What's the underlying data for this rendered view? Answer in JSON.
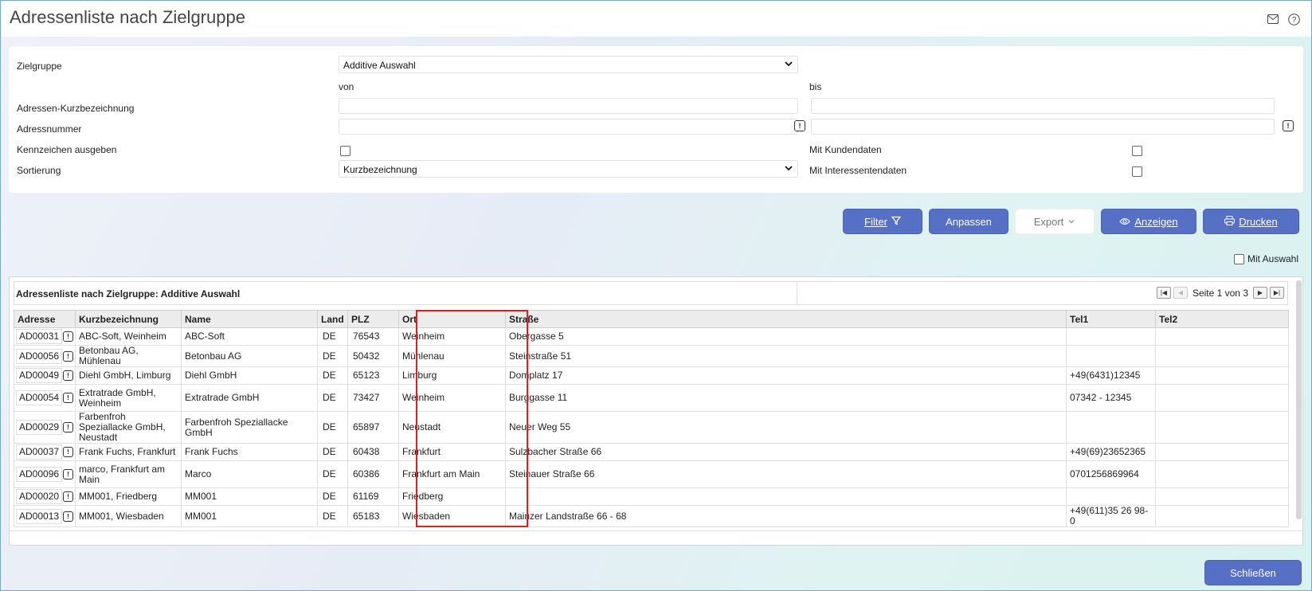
{
  "window": {
    "title": "Adressenliste nach Zielgruppe"
  },
  "header_icons": [
    "mail-icon",
    "help-icon"
  ],
  "form": {
    "zielgruppe_label": "Zielgruppe",
    "zielgruppe_value": "Additive Auswahl",
    "von_label": "von",
    "bis_label": "bis",
    "kurzbez_label": "Adressen-Kurzbezeichnung",
    "kurzbez_von": "",
    "kurzbez_bis": "",
    "adrnr_label": "Adressnummer",
    "adrnr_von": "",
    "adrnr_bis": "",
    "kennzeichen_label": "Kennzeichen ausgeben",
    "kennzeichen_checked": false,
    "sortierung_label": "Sortierung",
    "sortierung_value": "Kurzbezeichnung",
    "kundendaten_label": "Mit Kundendaten",
    "kundendaten_checked": false,
    "interessenten_label": "Mit Interessentendaten",
    "interessenten_checked": false
  },
  "actions": {
    "filter_label": "Filter",
    "anpassen_label": "Anpassen",
    "export_label": "Export",
    "anzeigen_label": "Anzeigen",
    "drucken_label": "Drucken",
    "mit_auswahl_label": "Mit Auswahl",
    "mit_auswahl_checked": false,
    "schliessen_label": "Schließen"
  },
  "grid": {
    "title": "Adressenliste nach Zielgruppe: Additive Auswahl",
    "pager_text": "Seite 1 von 3",
    "highlight_color": "#e0201c",
    "columns": [
      "Adresse",
      "Kurzbezeichnung",
      "Name",
      "Land",
      "PLZ",
      "Ort",
      "Straße",
      "Tel1",
      "Tel2"
    ],
    "rows": [
      [
        "AD00031",
        "ABC-Soft, Weinheim",
        "ABC-Soft",
        "DE",
        "76543",
        "Weinheim",
        "Obergasse 5",
        "",
        ""
      ],
      [
        "AD00056",
        "Betonbau AG, Mühlenau",
        "Betonbau AG",
        "DE",
        "50432",
        "Mühlenau",
        "Steinstraße 51",
        "",
        ""
      ],
      [
        "AD00049",
        "Diehl GmbH, Limburg",
        "Diehl GmbH",
        "DE",
        "65123",
        "Limburg",
        "Domplatz 17",
        "+49(6431)12345",
        ""
      ],
      [
        "AD00054",
        "Extratrade GmbH, Weinheim",
        "Extratrade GmbH",
        "DE",
        "73427",
        "Weinheim",
        "Burggasse 11",
        "07342 - 12345",
        ""
      ],
      [
        "AD00029",
        "Farbenfroh Speziallacke GmbH, Neustadt",
        "Farbenfroh Speziallacke GmbH",
        "DE",
        "65897",
        "Neustadt",
        "Neuer Weg 55",
        "",
        ""
      ],
      [
        "AD00037",
        "Frank Fuchs, Frankfurt",
        "Frank Fuchs",
        "DE",
        "60438",
        "Frankfurt",
        "Sulzbacher Straße 66",
        "+49(69)23652365",
        ""
      ],
      [
        "AD00096",
        "marco, Frankfurt am Main",
        "Marco",
        "DE",
        "60386",
        "Frankfurt am Main",
        "Steinauer Straße 66",
        "0701256869964",
        ""
      ],
      [
        "AD00020",
        "MM001, Friedberg",
        "MM001",
        "DE",
        "61169",
        "Friedberg",
        "",
        "",
        ""
      ],
      [
        "AD00013",
        "MM001, Wiesbaden",
        "MM001",
        "DE",
        "65183",
        "Wiesbaden",
        "Mainzer Landstraße 66 - 68",
        "+49(611)35 26 98-0",
        ""
      ]
    ]
  }
}
